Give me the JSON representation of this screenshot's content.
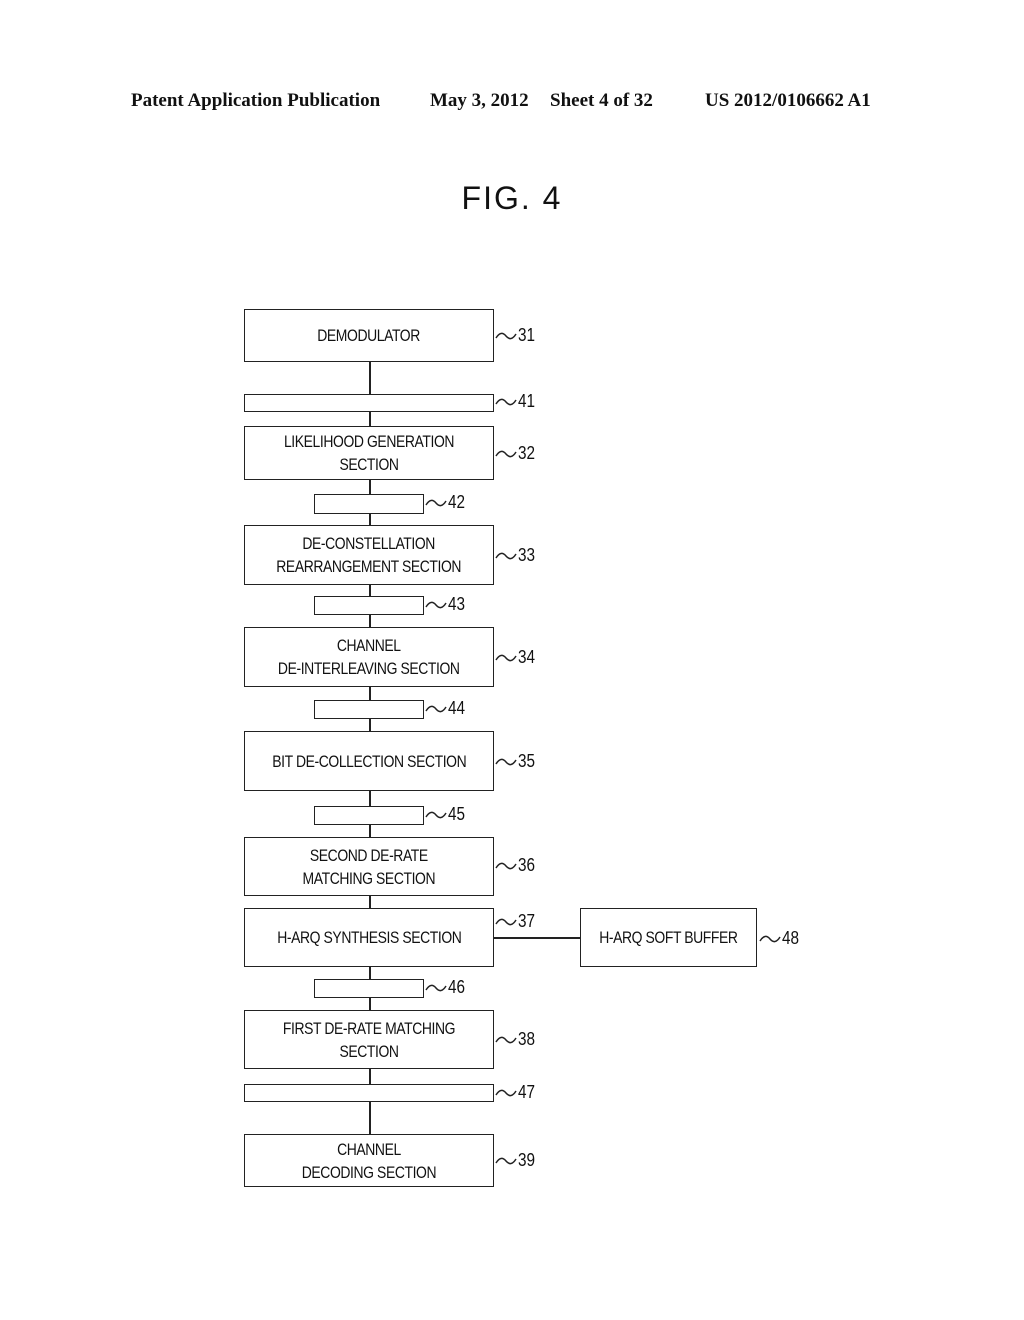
{
  "header": {
    "publication": "Patent Application Publication",
    "date": "May 3, 2012",
    "sheet": "Sheet 4 of 32",
    "number": "US 2012/0106662 A1"
  },
  "figure": {
    "title": "FIG. 4"
  },
  "blocks": [
    {
      "id": "31",
      "label": "DEMODULATOR"
    },
    {
      "id": "32",
      "label": "LIKELIHOOD GENERATION SECTION"
    },
    {
      "id": "33",
      "label": "DE-CONSTELLATION\nREARRANGEMENT SECTION"
    },
    {
      "id": "34",
      "label": "CHANNEL\nDE-INTERLEAVING SECTION"
    },
    {
      "id": "35",
      "label": "BIT DE-COLLECTION SECTION"
    },
    {
      "id": "36",
      "label": "SECOND DE-RATE\nMATCHING SECTION"
    },
    {
      "id": "37",
      "label": "H-ARQ SYNTHESIS SECTION"
    },
    {
      "id": "38",
      "label": "FIRST DE-RATE MATCHING SECTION"
    },
    {
      "id": "39",
      "label": "CHANNEL\nDECODING SECTION"
    },
    {
      "id": "48",
      "label": "H-ARQ SOFT BUFFER"
    }
  ],
  "buffers": [
    {
      "id": "41"
    },
    {
      "id": "42"
    },
    {
      "id": "43"
    },
    {
      "id": "44"
    },
    {
      "id": "45"
    },
    {
      "id": "46"
    },
    {
      "id": "47"
    }
  ]
}
